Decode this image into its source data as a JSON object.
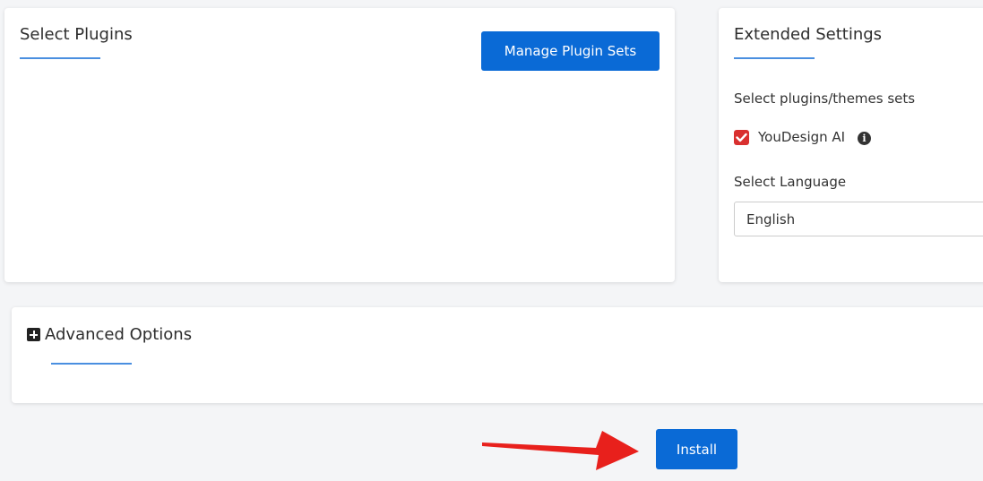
{
  "plugins_panel": {
    "title": "Select Plugins",
    "manage_button": "Manage Plugin Sets"
  },
  "extended_settings": {
    "title": "Extended Settings",
    "plugin_sets_label": "Select plugins/themes sets",
    "plugin_sets": [
      {
        "label": "YouDesign AI",
        "checked": true
      }
    ],
    "language_label": "Select Language",
    "language_value": "English"
  },
  "advanced_options": {
    "title": "Advanced Options"
  },
  "install_button": "Install",
  "colors": {
    "accent": "#0a6ad6",
    "underline": "#4a8fe0",
    "checkbox": "#d9302f",
    "arrow": "#e8201c"
  },
  "icons": {
    "info": "info-circle-icon",
    "expand": "plus-square-icon",
    "check": "check-icon",
    "annotation": "red-arrow-annotation"
  }
}
